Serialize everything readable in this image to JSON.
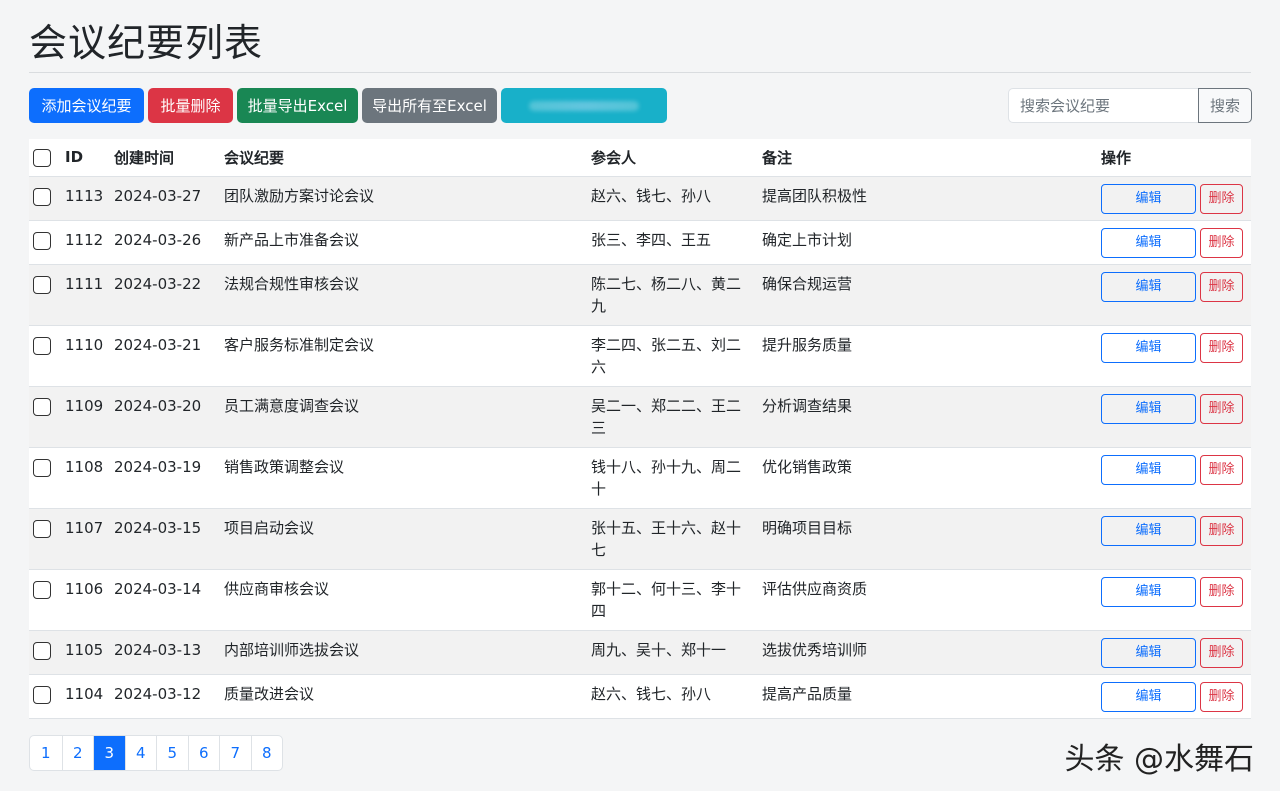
{
  "page_title": "会议纪要列表",
  "toolbar": {
    "add_label": "添加会议纪要",
    "batch_delete_label": "批量删除",
    "batch_export_label": "批量导出Excel",
    "export_all_label": "导出所有至Excel"
  },
  "search": {
    "placeholder": "搜索会议纪要",
    "button_label": "搜索"
  },
  "table": {
    "columns": [
      "ID",
      "创建时间",
      "会议纪要",
      "参会人",
      "备注",
      "操作"
    ],
    "edit_label": "编辑",
    "delete_label": "删除",
    "rows": [
      {
        "id": "1113",
        "date": "2024-03-27",
        "title": "团队激励方案讨论会议",
        "attendees": "赵六、钱七、孙八",
        "note": "提高团队积极性"
      },
      {
        "id": "1112",
        "date": "2024-03-26",
        "title": "新产品上市准备会议",
        "attendees": "张三、李四、王五",
        "note": "确定上市计划"
      },
      {
        "id": "1111",
        "date": "2024-03-22",
        "title": "法规合规性审核会议",
        "attendees": "陈二七、杨二八、黄二九",
        "note": "确保合规运营"
      },
      {
        "id": "1110",
        "date": "2024-03-21",
        "title": "客户服务标准制定会议",
        "attendees": "李二四、张二五、刘二六",
        "note": "提升服务质量"
      },
      {
        "id": "1109",
        "date": "2024-03-20",
        "title": "员工满意度调查会议",
        "attendees": "吴二一、郑二二、王二三",
        "note": "分析调查结果"
      },
      {
        "id": "1108",
        "date": "2024-03-19",
        "title": "销售政策调整会议",
        "attendees": "钱十八、孙十九、周二十",
        "note": "优化销售政策"
      },
      {
        "id": "1107",
        "date": "2024-03-15",
        "title": "项目启动会议",
        "attendees": "张十五、王十六、赵十七",
        "note": "明确项目目标"
      },
      {
        "id": "1106",
        "date": "2024-03-14",
        "title": "供应商审核会议",
        "attendees": "郭十二、何十三、李十四",
        "note": "评估供应商资质"
      },
      {
        "id": "1105",
        "date": "2024-03-13",
        "title": "内部培训师选拔会议",
        "attendees": "周九、吴十、郑十一",
        "note": "选拔优秀培训师"
      },
      {
        "id": "1104",
        "date": "2024-03-12",
        "title": "质量改进会议",
        "attendees": "赵六、钱七、孙八",
        "note": "提高产品质量"
      }
    ]
  },
  "pagination": {
    "pages": [
      "1",
      "2",
      "3",
      "4",
      "5",
      "6",
      "7",
      "8"
    ],
    "current": "3"
  },
  "watermark": "头条 @水舞石",
  "colors": {
    "primary": "#0d6efd",
    "danger": "#dc3545",
    "success": "#198754",
    "secondary": "#6c757d",
    "info": "#18b0c9"
  }
}
